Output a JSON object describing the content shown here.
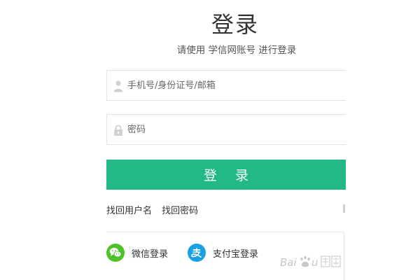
{
  "header": {
    "title": "登录",
    "subtitle": "请使用 学信网账号 进行登录"
  },
  "form": {
    "username_placeholder": "手机号/身份证号/邮箱",
    "password_placeholder": "密码",
    "login_label": "登 录"
  },
  "links": {
    "find_username": "找回用户名",
    "find_password": "找回密码"
  },
  "social": {
    "wechat_label": "微信登录",
    "alipay_label": "支付宝登录"
  },
  "watermark": {
    "brand": "Baidu"
  },
  "icons": {
    "user": "user-icon",
    "lock": "lock-icon",
    "wechat": "wechat-icon",
    "alipay": "alipay-icon"
  },
  "colors": {
    "primary_button": "#23b887",
    "wechat": "#4ec22a",
    "alipay": "#1aa1e5"
  }
}
